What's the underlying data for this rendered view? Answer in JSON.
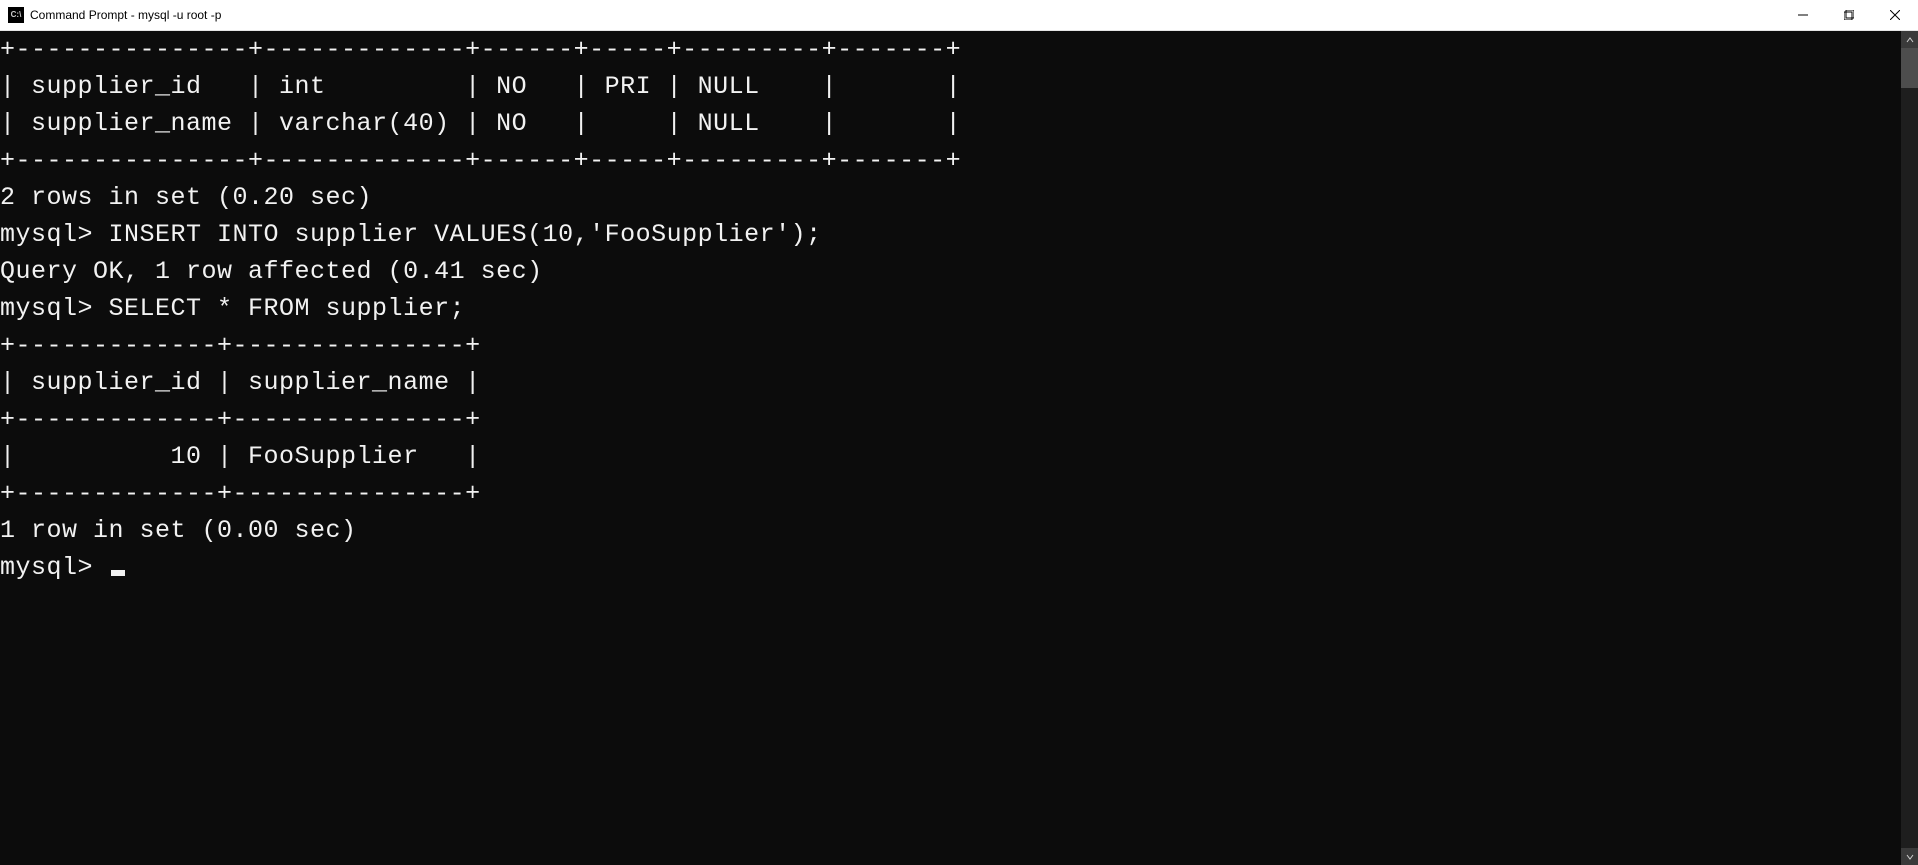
{
  "window": {
    "icon_text": "C:\\",
    "title": "Command Prompt - mysql  -u root -p"
  },
  "terminal": {
    "lines": [
      "+---------------+-------------+------+-----+---------+-------+",
      "| supplier_id   | int         | NO   | PRI | NULL    |       |",
      "| supplier_name | varchar(40) | NO   |     | NULL    |       |",
      "+---------------+-------------+------+-----+---------+-------+",
      "2 rows in set (0.20 sec)",
      "",
      "mysql> INSERT INTO supplier VALUES(10,'FooSupplier');",
      "Query OK, 1 row affected (0.41 sec)",
      "",
      "mysql> SELECT * FROM supplier;",
      "+-------------+---------------+",
      "| supplier_id | supplier_name |",
      "+-------------+---------------+",
      "|          10 | FooSupplier   |",
      "+-------------+---------------+",
      "1 row in set (0.00 sec)",
      "",
      "mysql> "
    ]
  }
}
